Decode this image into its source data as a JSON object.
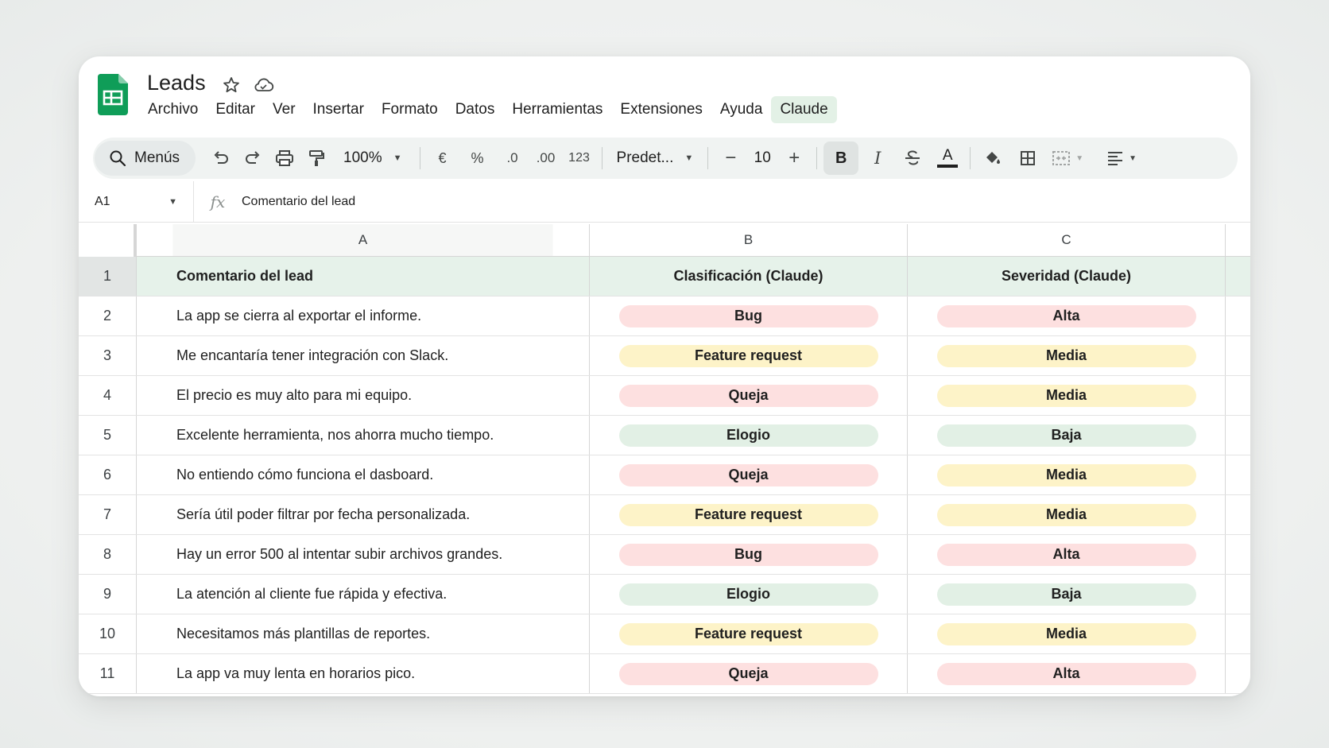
{
  "app": {
    "title": "Leads",
    "logo": "google-sheets-logo",
    "title_icons": [
      "star-icon",
      "cloud-icon"
    ]
  },
  "menu": {
    "items": [
      {
        "label": "Archivo"
      },
      {
        "label": "Editar"
      },
      {
        "label": "Ver"
      },
      {
        "label": "Insertar"
      },
      {
        "label": "Formato"
      },
      {
        "label": "Datos"
      },
      {
        "label": "Herramientas"
      },
      {
        "label": "Extensiones"
      },
      {
        "label": "Ayuda"
      },
      {
        "label": "Claude",
        "active": true
      }
    ]
  },
  "toolbar": {
    "search_label": "Menús",
    "zoom": "100%",
    "currency": "€",
    "percent": "%",
    "decrease_decimals": ".0",
    "increase_decimals": ".00",
    "number_format": "123",
    "font": "Predet...",
    "font_size": "10",
    "bold": "B",
    "italic": "I",
    "text_color_glyph": "A"
  },
  "formula_bar": {
    "cell_ref": "A1",
    "fx": "fx",
    "content": "Comentario del lead"
  },
  "grid": {
    "column_letters": [
      "A",
      "B",
      "C"
    ],
    "header": {
      "row_number": "1",
      "cells": [
        "Comentario del lead",
        "Clasificación (Claude)",
        "Severidad (Claude)"
      ]
    },
    "rows": [
      {
        "n": "2",
        "comment": "La app se cierra al exportar el informe.",
        "class": "Bug",
        "sev": "Alta"
      },
      {
        "n": "3",
        "comment": "Me encantaría tener integración con Slack.",
        "class": "Feature request",
        "sev": "Media"
      },
      {
        "n": "4",
        "comment": "El precio es muy alto para mi equipo.",
        "class": "Queja",
        "sev": "Media"
      },
      {
        "n": "5",
        "comment": "Excelente herramienta, nos ahorra mucho tiempo.",
        "class": "Elogio",
        "sev": "Baja"
      },
      {
        "n": "6",
        "comment": "No entiendo cómo funciona el dasboard.",
        "class": "Queja",
        "sev": "Media"
      },
      {
        "n": "7",
        "comment": "Sería útil poder filtrar por fecha personalizada.",
        "class": "Feature request",
        "sev": "Media"
      },
      {
        "n": "8",
        "comment": "Hay un error 500 al intentar subir archivos grandes.",
        "class": "Bug",
        "sev": "Alta"
      },
      {
        "n": "9",
        "comment": "La atención al cliente fue rápida y efectiva.",
        "class": "Elogio",
        "sev": "Baja"
      },
      {
        "n": "10",
        "comment": "Necesitamos más plantillas de reportes.",
        "class": "Feature request",
        "sev": "Media"
      },
      {
        "n": "11",
        "comment": "La app va muy lenta en horarios pico.",
        "class": "Queja",
        "sev": "Alta"
      }
    ]
  },
  "colors": {
    "sheets_green": "#0f9d58",
    "header_row_bg": "#e6f2ea",
    "pill_red": "#fde0e0",
    "pill_yellow": "#fdf3c8",
    "pill_green": "#e2f0e5",
    "claude_menu_bg": "#e3f1e6"
  },
  "pill_colors": {
    "Bug": "#fde0e0",
    "Queja": "#fde0e0",
    "Feature request": "#fdf3c8",
    "Elogio": "#e2f0e5",
    "Alta": "#fde0e0",
    "Media": "#fdf3c8",
    "Baja": "#e2f0e5"
  }
}
